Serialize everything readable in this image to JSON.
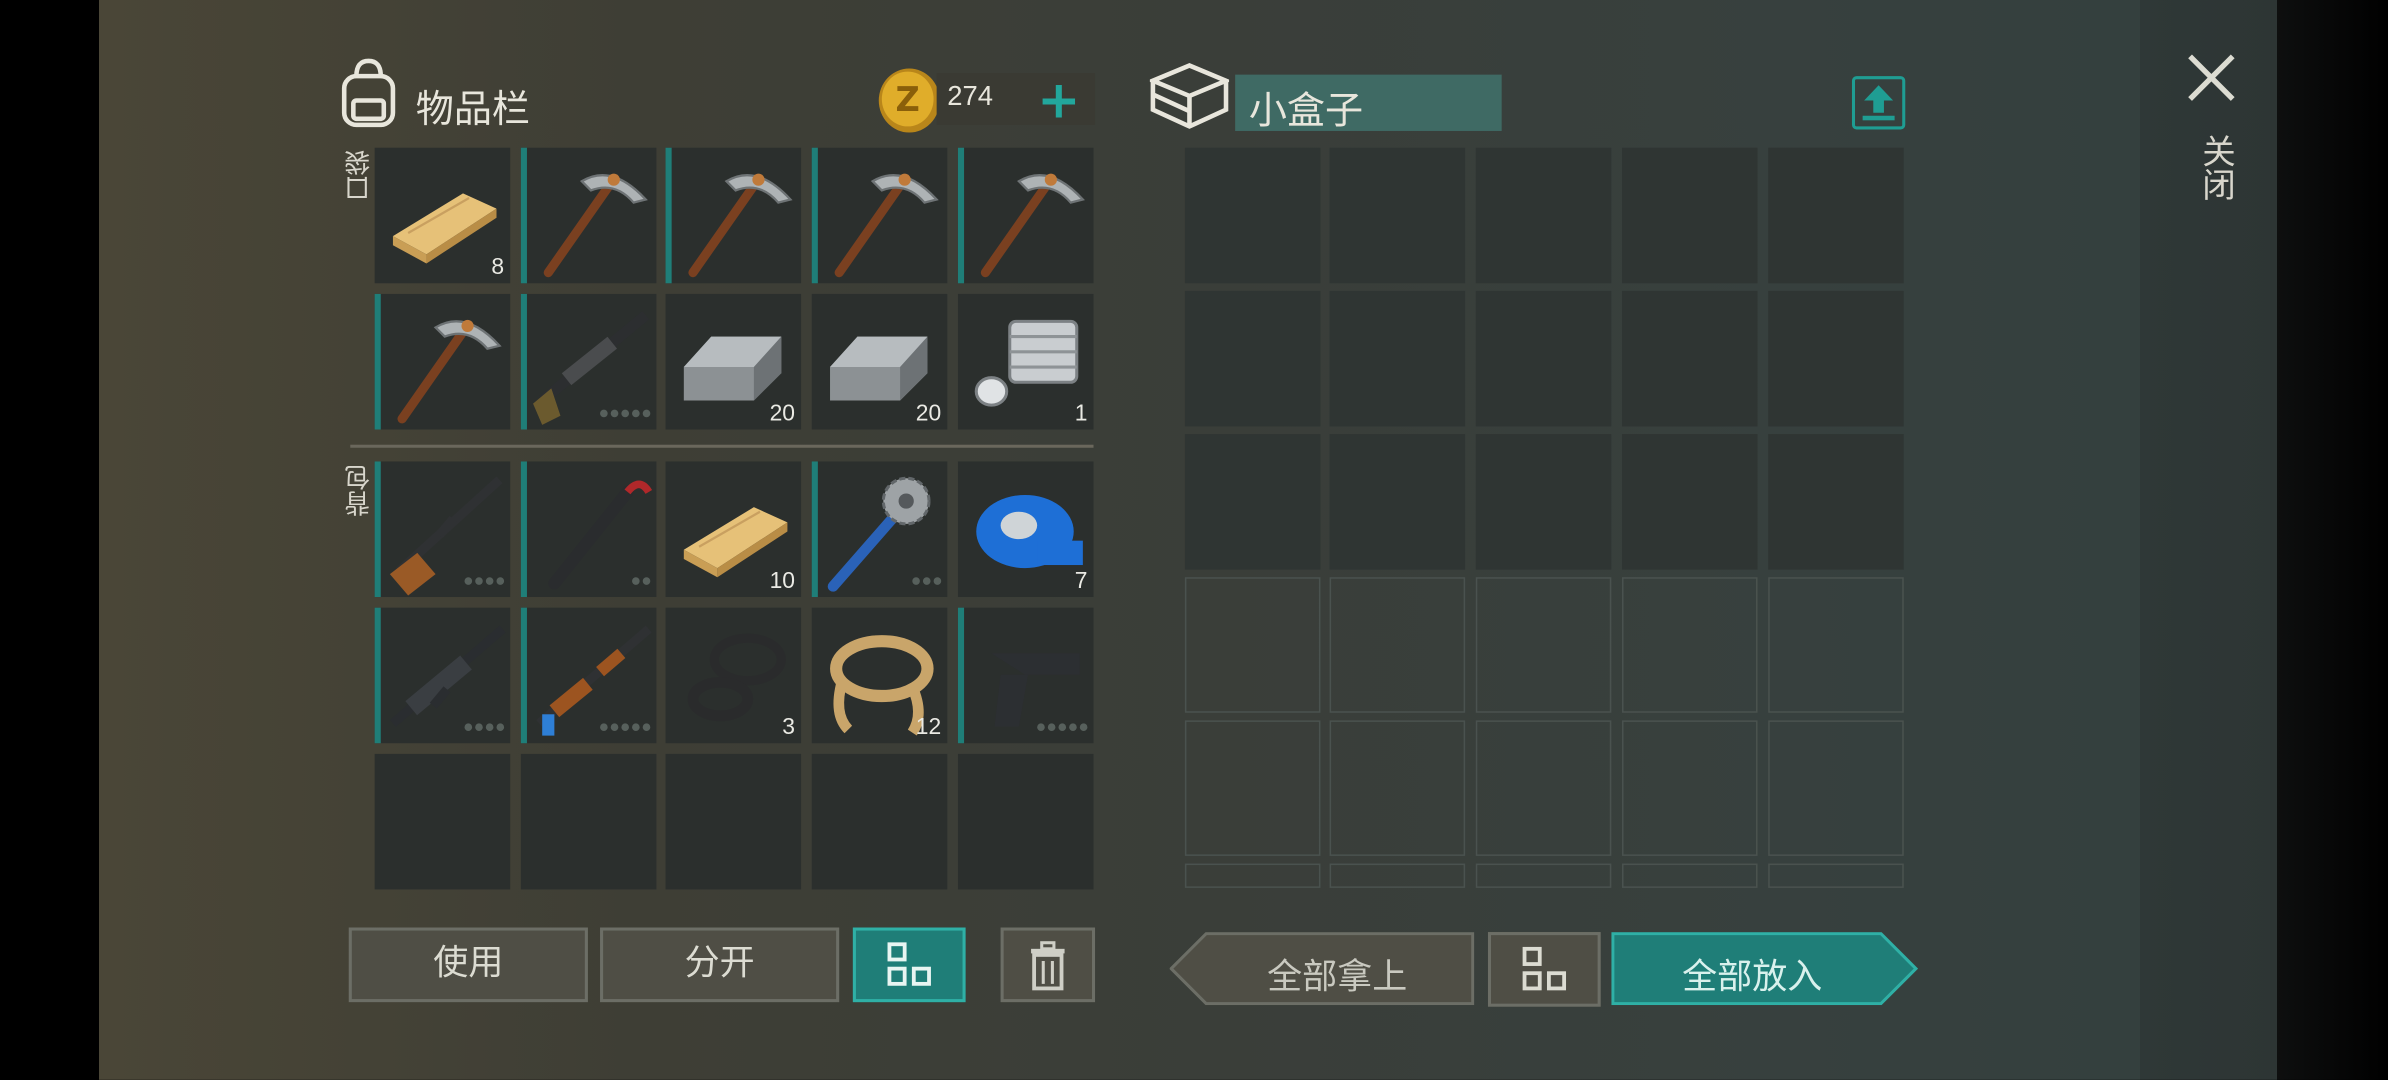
{
  "inventory": {
    "title": "物品栏",
    "coins": "274",
    "pocket_label": "口袋",
    "backpack_label": "背包",
    "pocket_slots": [
      {
        "item": "wood-plank",
        "qty": "8",
        "dots": 0,
        "bar": false
      },
      {
        "item": "pickaxe",
        "qty": "",
        "dots": 0,
        "bar": true
      },
      {
        "item": "pickaxe",
        "qty": "",
        "dots": 0,
        "bar": true
      },
      {
        "item": "pickaxe",
        "qty": "",
        "dots": 0,
        "bar": true
      },
      {
        "item": "pickaxe",
        "qty": "",
        "dots": 0,
        "bar": true
      },
      {
        "item": "pickaxe",
        "qty": "",
        "dots": 0,
        "bar": true
      },
      {
        "item": "shotgun",
        "qty": "",
        "dots": 5,
        "bar": true
      },
      {
        "item": "iron-ingot",
        "qty": "20",
        "dots": 0,
        "bar": false
      },
      {
        "item": "iron-ingot",
        "qty": "20",
        "dots": 0,
        "bar": false
      },
      {
        "item": "engine-part",
        "qty": "1",
        "dots": 0,
        "bar": false
      }
    ],
    "backpack_slots": [
      {
        "item": "rifle",
        "qty": "",
        "dots": 4,
        "bar": true
      },
      {
        "item": "crowbar",
        "qty": "",
        "dots": 2,
        "bar": true
      },
      {
        "item": "wood-plank",
        "qty": "10",
        "dots": 0,
        "bar": false
      },
      {
        "item": "saw-mace",
        "qty": "",
        "dots": 3,
        "bar": true
      },
      {
        "item": "tape",
        "qty": "7",
        "dots": 0,
        "bar": false
      },
      {
        "item": "m16",
        "qty": "",
        "dots": 4,
        "bar": true
      },
      {
        "item": "ak47",
        "qty": "",
        "dots": 5,
        "bar": true
      },
      {
        "item": "rubber-rings",
        "qty": "3",
        "dots": 0,
        "bar": false
      },
      {
        "item": "rope",
        "qty": "12",
        "dots": 0,
        "bar": false
      },
      {
        "item": "pistol",
        "qty": "",
        "dots": 5,
        "bar": true
      }
    ]
  },
  "container": {
    "title": "小盒子"
  },
  "buttons": {
    "use": "使用",
    "split": "分开",
    "take_all": "全部拿上",
    "put_all": "全部放入"
  },
  "close_label": "关闭",
  "colors": {
    "accent": "#1f7e78",
    "coin": "#d9a520"
  }
}
